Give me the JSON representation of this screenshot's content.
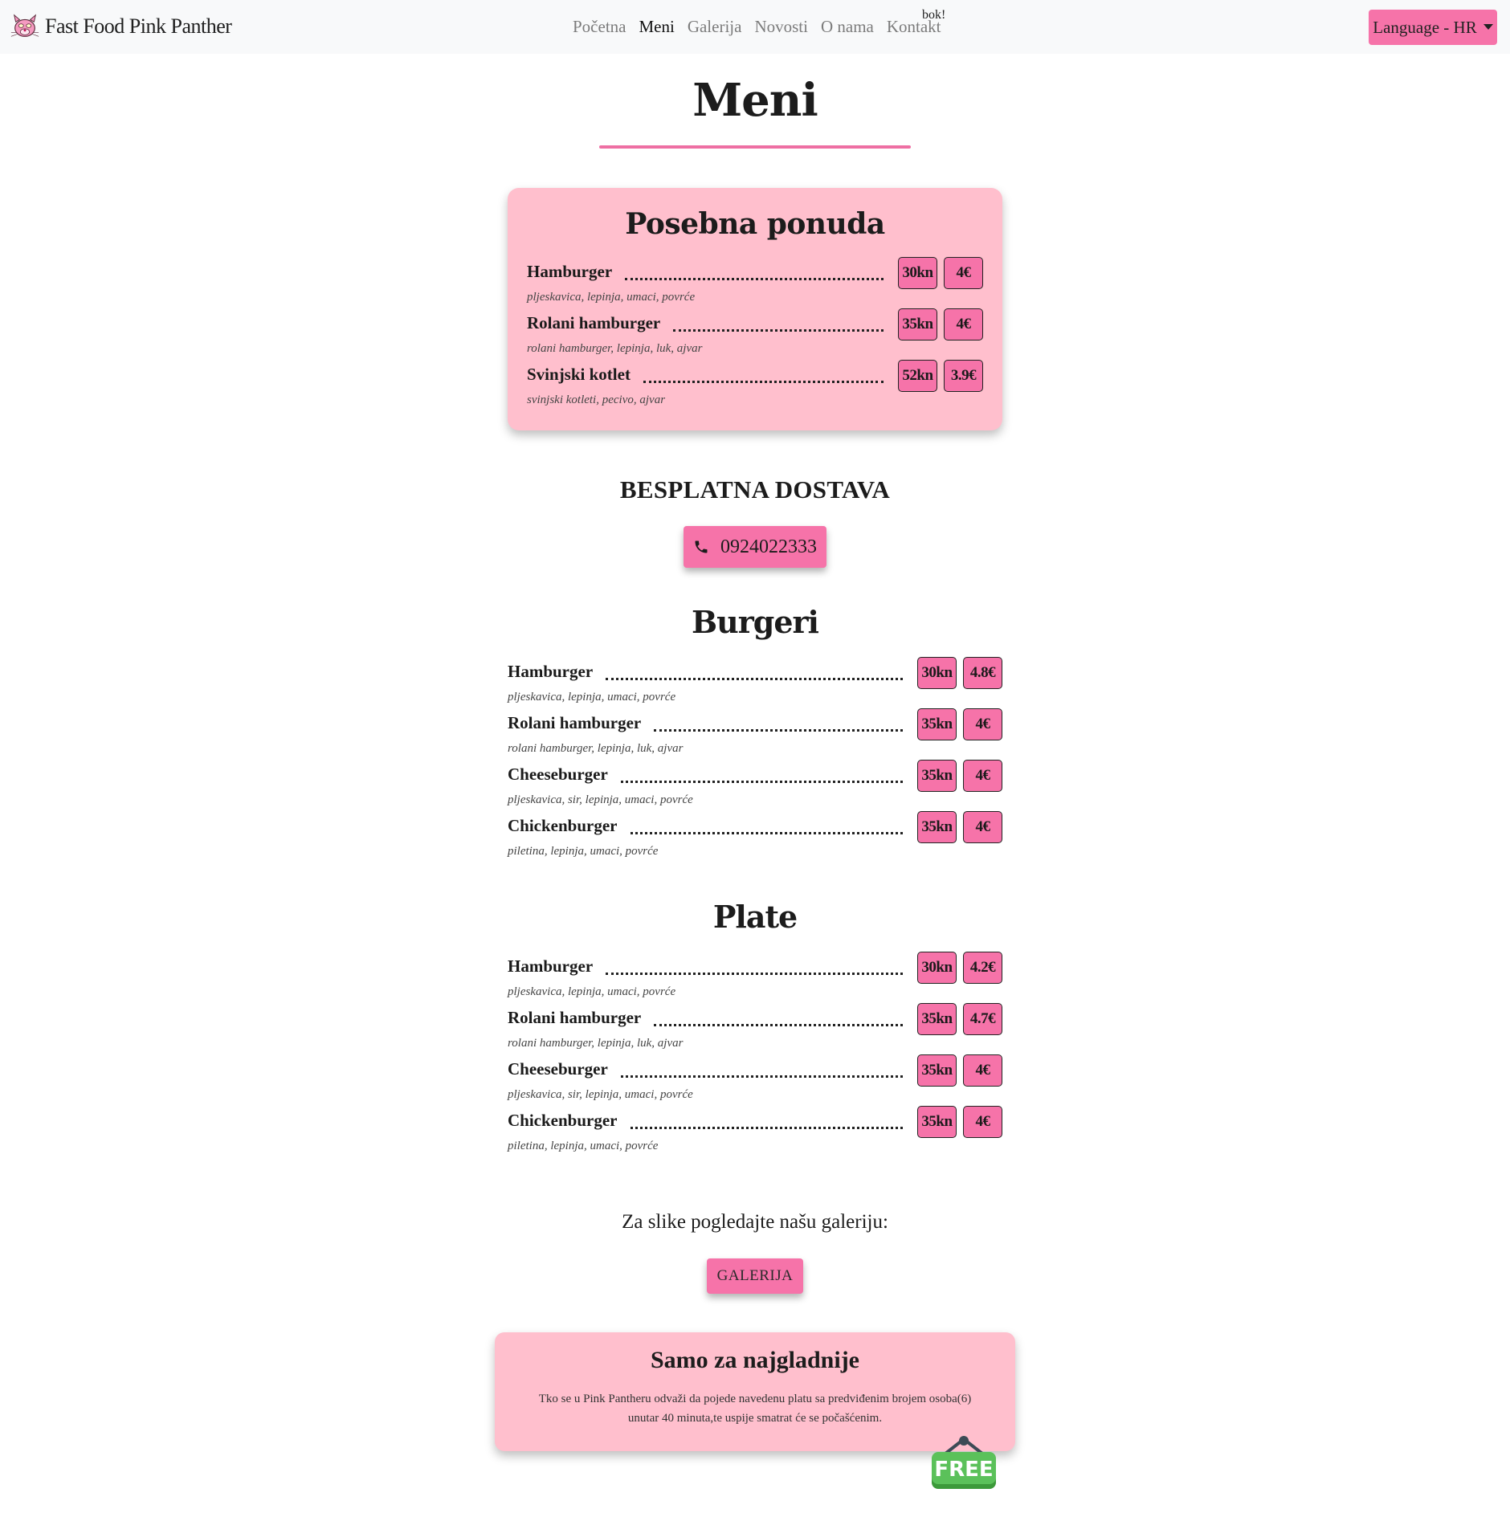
{
  "nav": {
    "brand": "Fast Food Pink Panther",
    "links": [
      "Početna",
      "Meni",
      "Galerija",
      "Novosti",
      "O nama",
      "Kontakt"
    ],
    "active_link": "Meni",
    "sup_text": "bok!",
    "language_label": "Language - HR"
  },
  "page_title": "Meni",
  "special": {
    "title": "Posebna ponuda",
    "items": [
      {
        "name": "Hamburger",
        "desc": "pljeskavica, lepinja, umaci, povrće",
        "price_kn": "30kn",
        "price_eur": "4€"
      },
      {
        "name": "Rolani hamburger",
        "desc": "rolani hamburger, lepinja, luk, ajvar",
        "price_kn": "35kn",
        "price_eur": "4€"
      },
      {
        "name": "Svinjski kotlet",
        "desc": "svinjski kotleti, pecivo, ajvar",
        "price_kn": "52kn",
        "price_eur": "3.9€"
      }
    ]
  },
  "delivery": {
    "heading": "BESPLATNA DOSTAVA",
    "phone": "0924022333"
  },
  "burgeri": {
    "title": "Burgeri",
    "items": [
      {
        "name": "Hamburger",
        "desc": "pljeskavica, lepinja, umaci, povrće",
        "price_kn": "30kn",
        "price_eur": "4.8€"
      },
      {
        "name": "Rolani hamburger",
        "desc": "rolani hamburger, lepinja, luk, ajvar",
        "price_kn": "35kn",
        "price_eur": "4€"
      },
      {
        "name": "Cheeseburger",
        "desc": "pljeskavica, sir, lepinja, umaci, povrće",
        "price_kn": "35kn",
        "price_eur": "4€"
      },
      {
        "name": "Chickenburger",
        "desc": "piletina, lepinja, umaci, povrće",
        "price_kn": "35kn",
        "price_eur": "4€"
      }
    ]
  },
  "plate": {
    "title": "Plate",
    "items": [
      {
        "name": "Hamburger",
        "desc": "pljeskavica, lepinja, umaci, povrće",
        "price_kn": "30kn",
        "price_eur": "4.2€"
      },
      {
        "name": "Rolani hamburger",
        "desc": "rolani hamburger, lepinja, luk, ajvar",
        "price_kn": "35kn",
        "price_eur": "4.7€"
      },
      {
        "name": "Cheeseburger",
        "desc": "pljeskavica, sir, lepinja, umaci, povrće",
        "price_kn": "35kn",
        "price_eur": "4€"
      },
      {
        "name": "Chickenburger",
        "desc": "piletina, lepinja, umaci, povrće",
        "price_kn": "35kn",
        "price_eur": "4€"
      }
    ]
  },
  "gallery": {
    "text": "Za slike pogledajte našu galeriju:",
    "button_label": "GALERIJA"
  },
  "hungry": {
    "title": "Samo za najgladnije",
    "text": "Tko se u Pink Pantheru odvaži da pojede navedenu platu sa predviđenim brojem osoba(6) unutar 40 minuta,te uspije smatrat će se počašćenim.",
    "sign_label": "FREE"
  },
  "colors": {
    "accent": "#f673a9",
    "card_bg": "#ffbfcd",
    "rule": "#ee6fa3"
  },
  "icons": {
    "brand": "pink-panther-logo-icon",
    "phone": "phone-icon",
    "dropdown": "caret-down-icon",
    "sign": "free-sign-icon"
  }
}
